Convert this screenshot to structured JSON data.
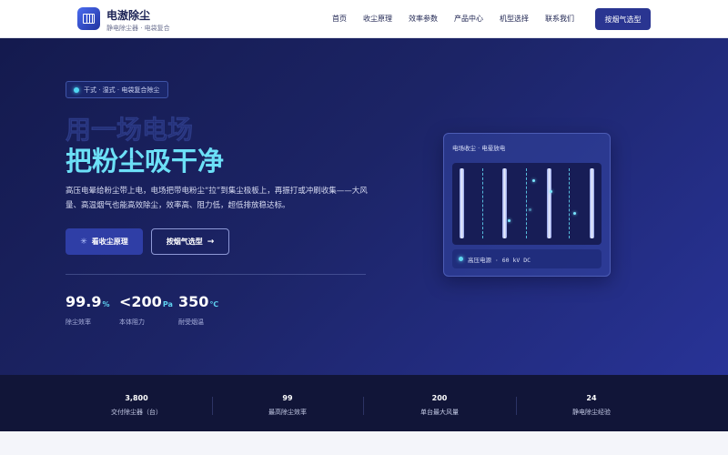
{
  "brand": {
    "name": "电滶除尘",
    "subtitle": "静电除尘器 · 电袋复合",
    "logo_icon": "electrode-grid-icon"
  },
  "nav": [
    "首页",
    "收尘原理",
    "效率参数",
    "产品中心",
    "机型选择",
    "联系我们"
  ],
  "header_cta": "按烟气选型",
  "hero": {
    "badge": "干式 · 湿式 · 电袋复合除尘",
    "headline_line1": "用一场电场",
    "headline_line2": "把粉尘吸干净",
    "description": "高压电晕给粉尘带上电，电场把带电粉尘“拉”到集尘极板上，再振打或冲刷收集——大风量、高温烟气也能高效除尘，效率高、阻力低，超低排放稳达标。",
    "primary_button": "看收尘原理",
    "primary_icon": "sparkle-icon",
    "secondary_button": "按烟气选型",
    "secondary_icon": "arrow-right-icon",
    "stats": [
      {
        "value": "99.9",
        "unit": "%",
        "label": "除尘效率"
      },
      {
        "value": "<200",
        "unit": "Pa",
        "label": "本体阻力"
      },
      {
        "value": "350",
        "unit": "℃",
        "label": "耐受烟温"
      }
    ]
  },
  "panel": {
    "title": "电场收尘 · 电晕放电",
    "status": "高压电源 · 60 kV DC"
  },
  "band": [
    {
      "value": "3,800",
      "label": "交付除尘器（台）"
    },
    {
      "value": "99",
      "label": "最高除尘效率"
    },
    {
      "value": "200",
      "label": "单台最大风量"
    },
    {
      "value": "24",
      "label": "静电除尘经验"
    }
  ],
  "colors": {
    "accent": "#6ce0f7",
    "primary": "#2a3591",
    "hero_bg": "#1c2466",
    "band_bg": "#111538"
  }
}
